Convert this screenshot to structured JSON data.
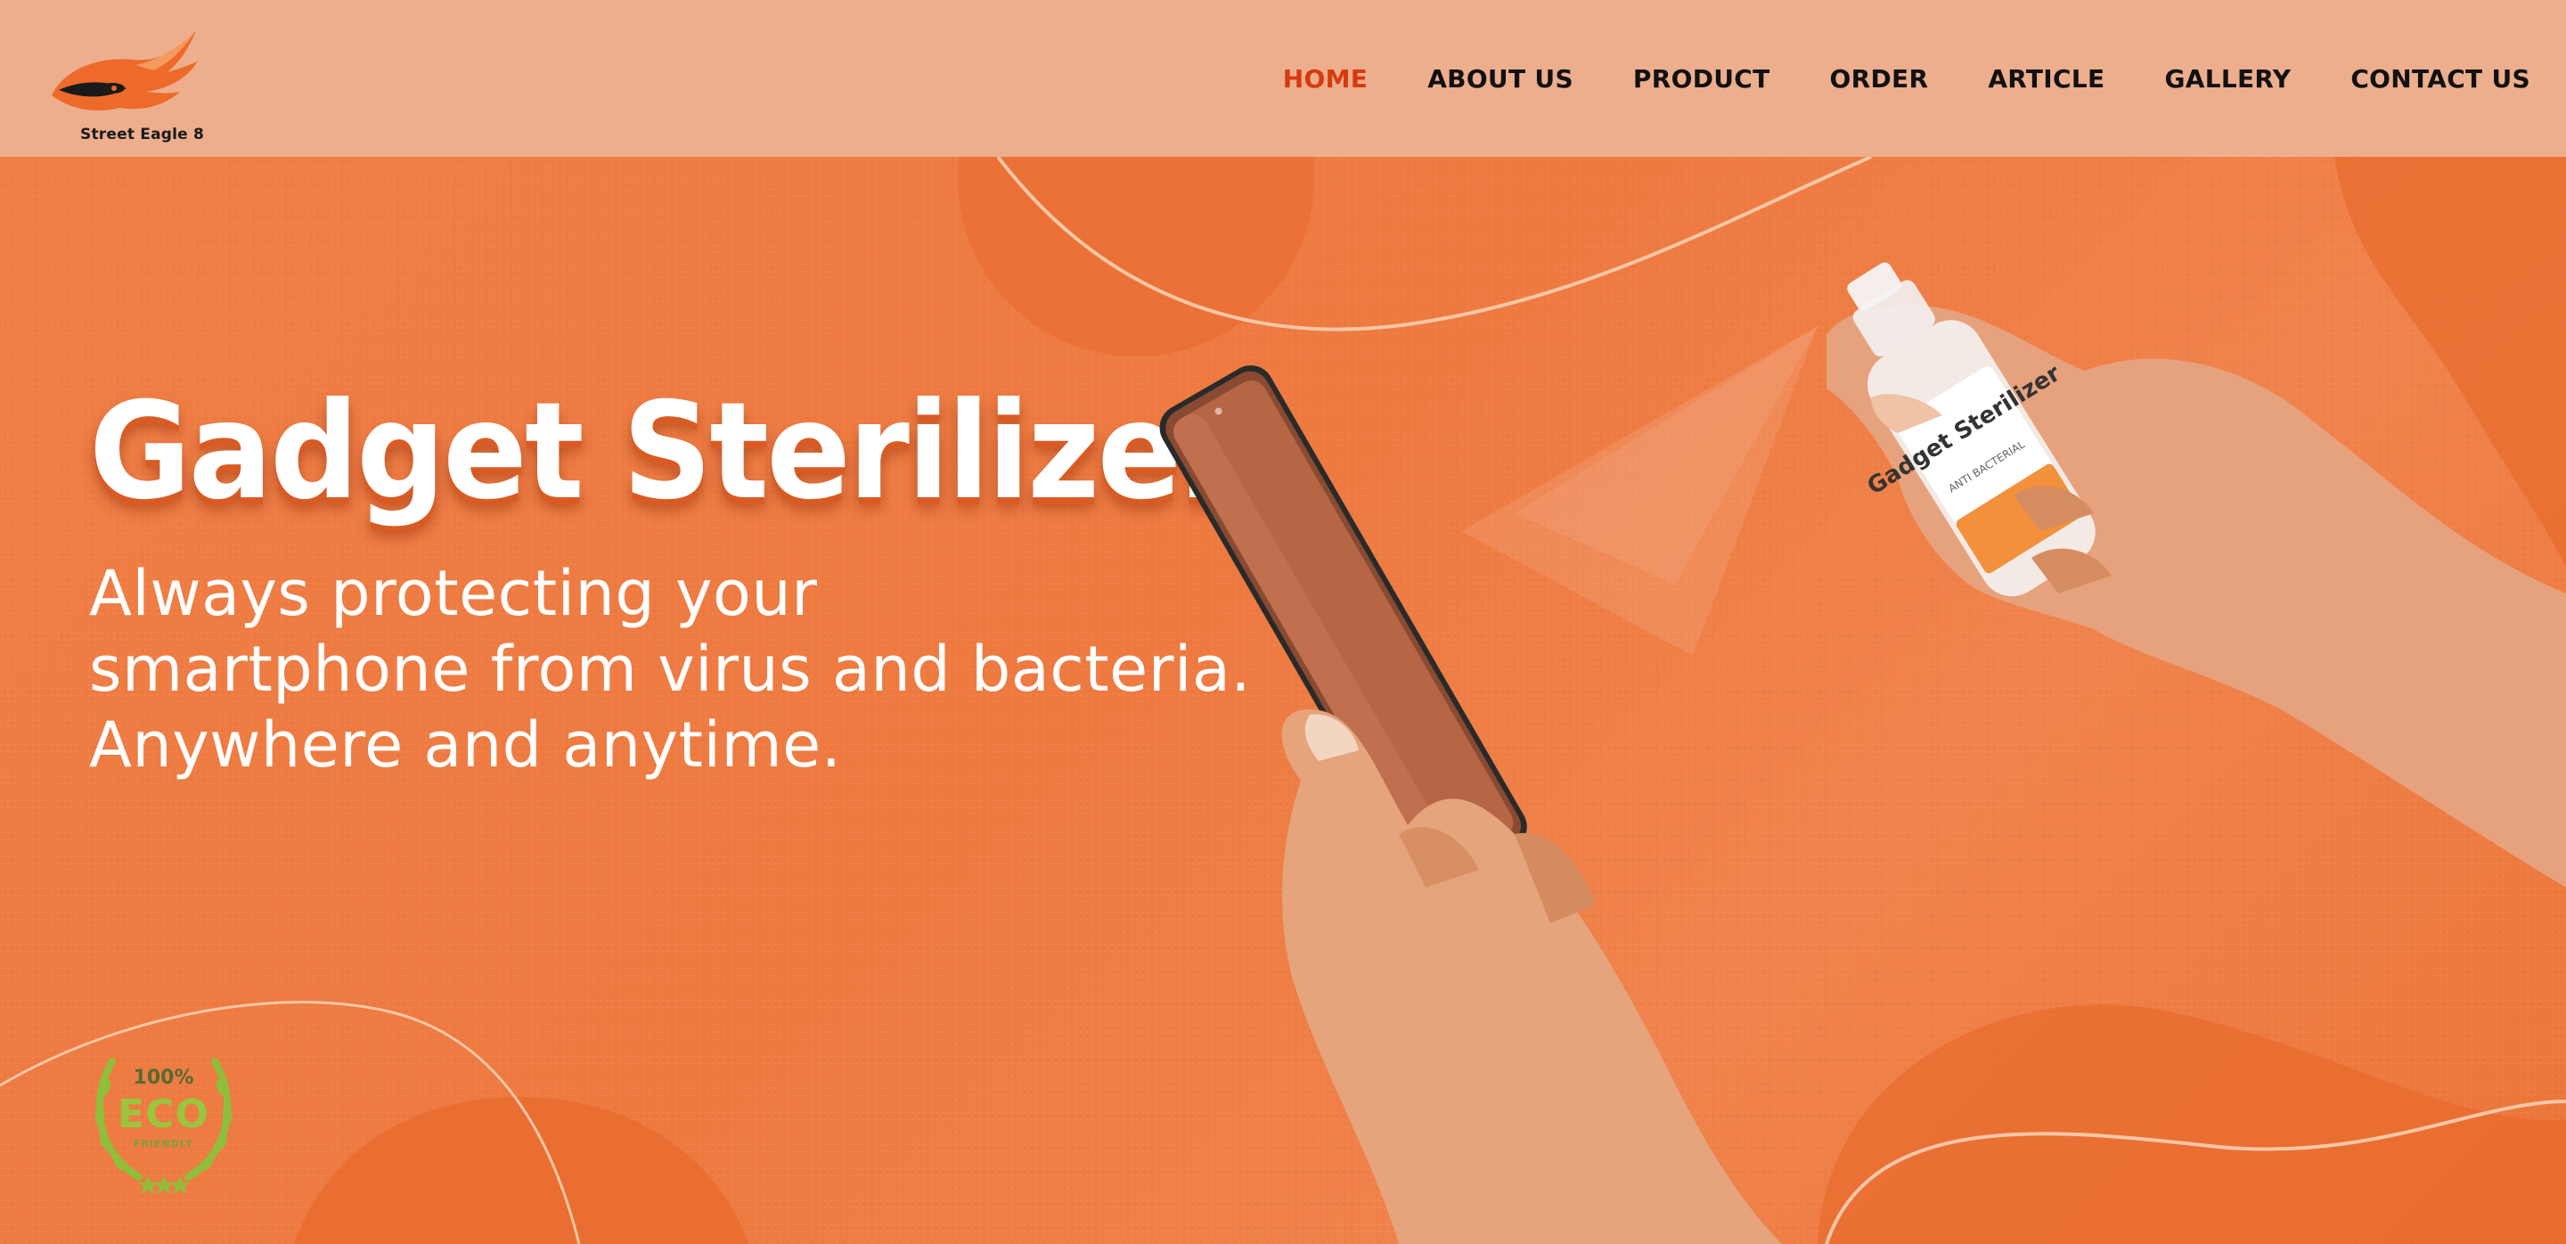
{
  "header": {
    "logo_text": "Street Eagle 8",
    "nav": [
      {
        "label": "HOME",
        "active": true
      },
      {
        "label": "ABOUT US",
        "active": false
      },
      {
        "label": "PRODUCT",
        "active": false
      },
      {
        "label": "ORDER",
        "active": false
      },
      {
        "label": "ARTICLE",
        "active": false
      },
      {
        "label": "GALLERY",
        "active": false
      },
      {
        "label": "CONTACT US",
        "active": false
      }
    ]
  },
  "hero": {
    "title": "Gadget Sterilizer",
    "subtitle_lines": [
      "Always protecting your",
      "smartphone from virus and bacteria.",
      "Anywhere and anytime."
    ],
    "bottle_label": "Gadget Sterilizer",
    "bottle_sublabel": "ANTI BACTERIAL",
    "eco_badge": {
      "top": "100%",
      "main": "ECO",
      "sub": "FRIENDLY"
    }
  },
  "colors": {
    "header_bg": "#edae8d",
    "hero_bg": "#ee7b42",
    "active_nav": "#d63a10",
    "nav_text": "#111111",
    "text_white": "#ffffff"
  }
}
